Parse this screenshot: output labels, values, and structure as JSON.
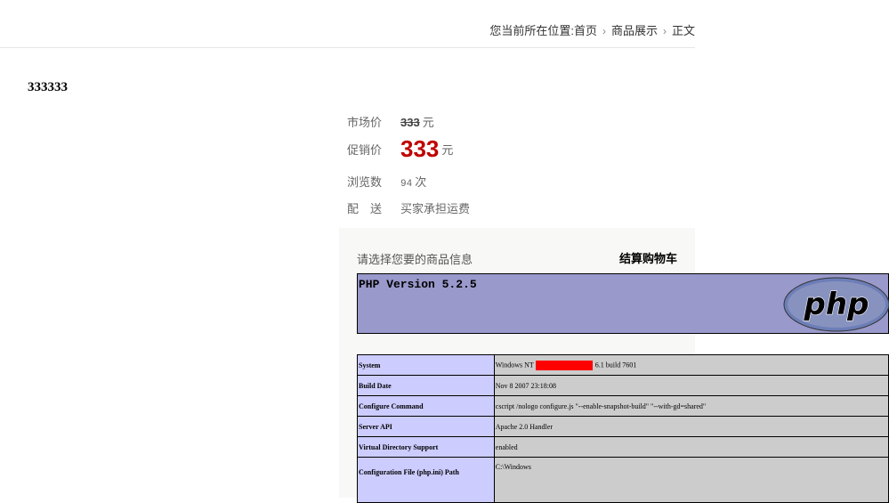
{
  "breadcrumb": {
    "prefix": "您当前所在位置:",
    "items": [
      "首页",
      "商品展示",
      "正文"
    ],
    "separator": "›"
  },
  "product": {
    "title": "333333",
    "market_price_label": "市场价",
    "market_price": "333",
    "promo_price_label": "促销价",
    "promo_price": "333",
    "currency_unit": "元",
    "views_label": "浏览数",
    "views": "94",
    "views_unit": "次",
    "shipping_label": "配　送",
    "shipping_value": "买家承担运费"
  },
  "panel": {
    "prompt": "请选择您要的商品信息",
    "checkout_label": "结算购物车"
  },
  "phpinfo": {
    "version": "PHP Version 5.2.5",
    "logo_text": "php",
    "rows": [
      {
        "key": "System",
        "value_before": "Windows NT",
        "value_after": "6.1 build 7601"
      },
      {
        "key": "Build Date",
        "value": "Nov 8 2007 23:18:08"
      },
      {
        "key": "Configure Command",
        "value": "cscript /nologo configure.js \"--enable-snapshot-build\" \"--with-gd=shared\""
      },
      {
        "key": "Server API",
        "value": "Apache 2.0 Handler"
      },
      {
        "key": "Virtual Directory Support",
        "value": "enabled"
      },
      {
        "key": "Configuration File (php.ini) Path",
        "value": "C:\\Windows"
      }
    ]
  },
  "colors": {
    "promo_price": "#c00000",
    "php_header_bg": "#9999cc",
    "php_key_bg": "#ccccff",
    "php_value_bg": "#cccccc",
    "redaction": "#ff0000"
  }
}
